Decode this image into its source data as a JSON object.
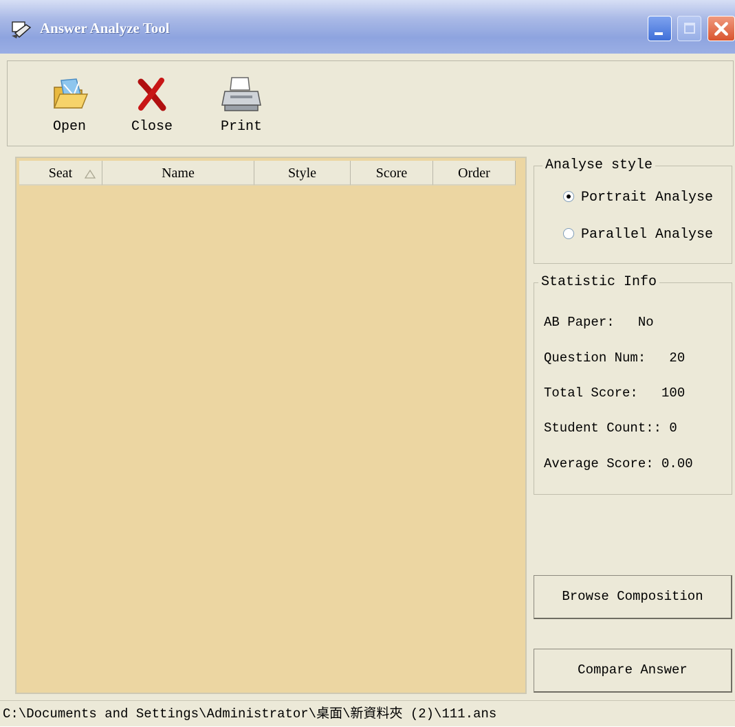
{
  "window": {
    "title": "Answer Analyze Tool"
  },
  "toolbar": {
    "open_label": "Open",
    "close_label": "Close",
    "print_label": "Print"
  },
  "list": {
    "columns": [
      "Seat",
      "Name",
      "Style",
      "Score",
      "Order"
    ],
    "sorted_column": "Seat",
    "sort_direction": "ascending",
    "rows": []
  },
  "analyse_style": {
    "title": "Analyse style",
    "options": [
      {
        "label": "Portrait Analyse",
        "selected": true
      },
      {
        "label": "Parallel Analyse",
        "selected": false
      }
    ]
  },
  "statistic_info": {
    "title": "Statistic Info",
    "ab_paper": "AB Paper:   No",
    "question_num": "Question Num:   20",
    "total_score": "Total Score:   100",
    "student_count": "Student Count:: 0",
    "average_score": "Average Score: 0.00"
  },
  "buttons": {
    "browse_composition": "Browse Composition",
    "compare_answer": "Compare Answer"
  },
  "status_bar": {
    "path": "C:\\Documents and Settings\\Administrator\\桌面\\新資料夾 (2)\\111.ans"
  },
  "colors": {
    "list_background": "#ecd6a2",
    "window_face": "#ece9d8",
    "titlebar": "#9aaee4",
    "close_button": "#d9542f"
  },
  "icons": {
    "app": "app-tool-icon",
    "open": "open-folder-icon",
    "close": "red-x-icon",
    "print": "printer-icon"
  }
}
